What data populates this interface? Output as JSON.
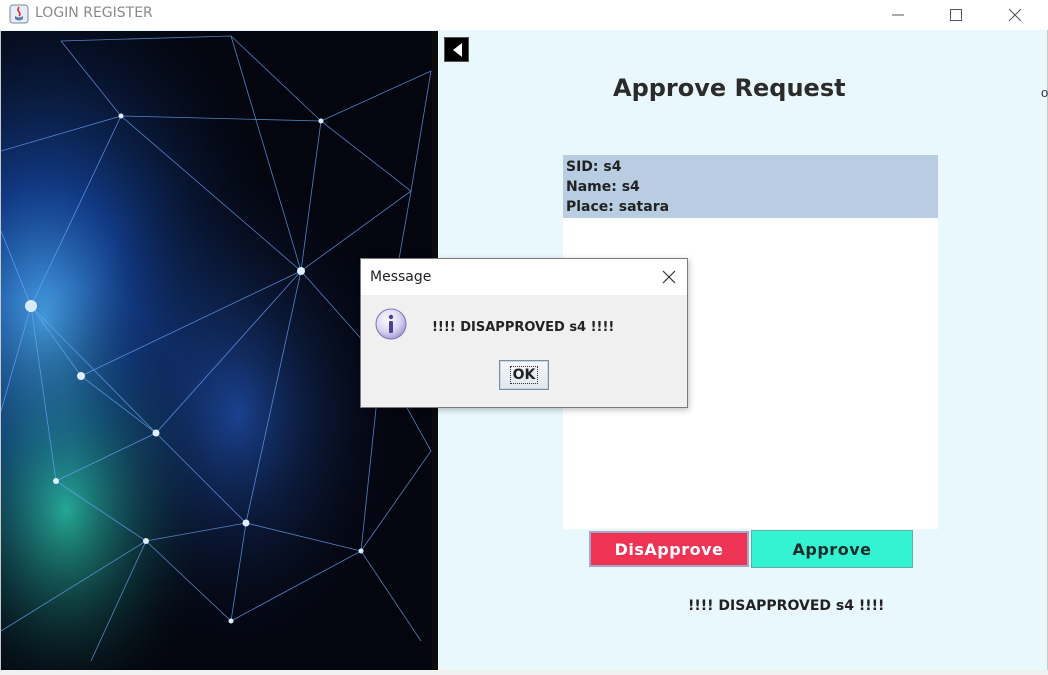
{
  "window": {
    "title": "LOGIN REGISTER"
  },
  "main": {
    "title": "Approve Request",
    "request": {
      "sid": "SID: s4",
      "name": "Name: s4",
      "place": "Place: satara"
    },
    "disapprove_label": "DisApprove",
    "approve_label": "Approve",
    "status": "!!!! DISAPPROVED s4 !!!!",
    "edge_fragment": "o"
  },
  "dialog": {
    "title": "Message",
    "message": "!!!! DISAPPROVED s4 !!!!",
    "ok_label": "OK",
    "icon": "info-icon"
  },
  "colors": {
    "panel_bg": "#e8f8fd",
    "request_header": "#b8cde2",
    "disapprove": "#ee3355",
    "approve": "#33f3d3"
  }
}
